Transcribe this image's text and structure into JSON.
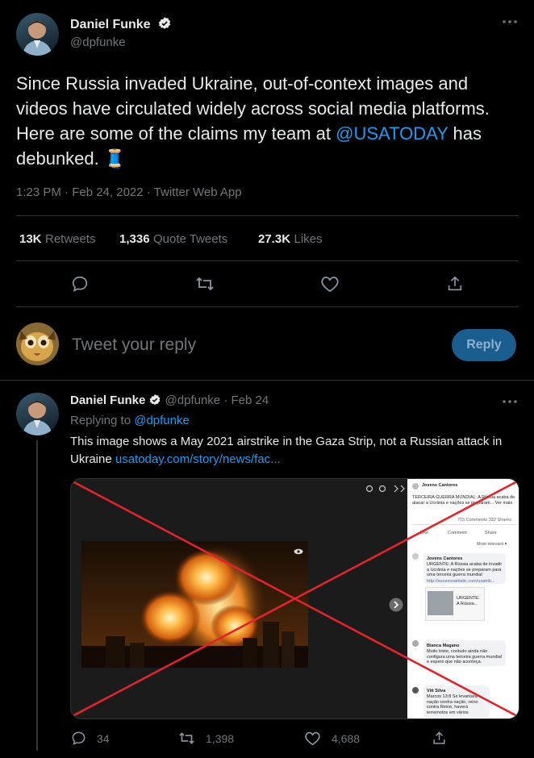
{
  "main_tweet": {
    "display_name": "Daniel Funke",
    "handle": "@dpfunke",
    "text_before_mention": "Since Russia invaded Ukraine, out-of-context images and videos have circulated widely across social media platforms. Here are some of the claims my team at ",
    "mention": "@USATODAY",
    "text_after_mention": " has debunked. 🧵",
    "timestamp": "1:23 PM · Feb 24, 2022 · Twitter Web App",
    "stats": {
      "retweets_count": "13K",
      "retweets_label": "Retweets",
      "quotes_count": "1,336",
      "quotes_label": "Quote Tweets",
      "likes_count": "27.3K",
      "likes_label": "Likes"
    }
  },
  "reply_composer": {
    "placeholder": "Tweet your reply",
    "button_label": "Reply"
  },
  "thread_tweet": {
    "display_name": "Daniel Funke",
    "handle": "@dpfunke",
    "date": "· Feb 24",
    "replying_label": "Replying to ",
    "replying_to": "@dpfunke",
    "text": "This image shows a May 2021 airstrike in the Gaza Strip, not a Russian attack in Ukraine ",
    "link": "usatoday.com/story/news/fac...",
    "embedded_fb": {
      "poster": "Jovens Cantores",
      "headline": "TERCEIRA GUERRA MUNDIAL: A Rússia acaba de atacar a Ucrânia e nações se preparam... Ver mais",
      "counts": "715 Comments 332 Shares",
      "like": "Like",
      "comment": "Comment",
      "share": "Share",
      "sort": "Most relevant ▾",
      "c1_author": "Jovens Cantores",
      "c1_text": "URGENTE: A Rússia acaba de invadir a Ucrânia e nações se preparam para uma terceira guerra mundial",
      "c1_link": "http://sucessoartistic.com/usatrib...",
      "c1_card": "URGENTE: A Rússia...",
      "c2_author": "Bianca Magano",
      "c2_text": "Muito triste, contudo ainda não configura uma terceira guerra mundial e espero que não aconteça.",
      "c3_author": "Vitt Silva",
      "c3_text": "Marcos 13:8 Se levantará nação contra nação, reino contra Reino, haverá terremotos em vários"
    },
    "counts": {
      "replies": "34",
      "retweets": "1,398",
      "likes": "4,688"
    }
  },
  "colors": {
    "accent": "#1d9bf0",
    "cross": "#e0242c"
  }
}
